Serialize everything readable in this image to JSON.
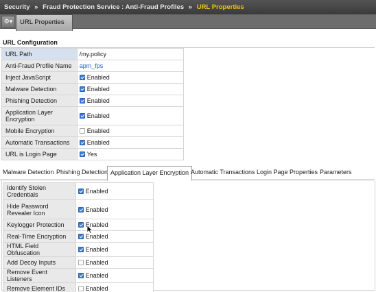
{
  "breadcrumb": {
    "items": [
      "Security",
      "Fraud Protection Service : Anti-Fraud Profiles",
      "URL Properties"
    ],
    "separator": "»"
  },
  "toolbar": {
    "gear_icon": "gear-icon",
    "gear_caret": "▾",
    "tab_label": "URL Properties"
  },
  "url_configuration": {
    "title": "URL Configuration",
    "rows": [
      {
        "label": "URL Path",
        "value": "/my.policy"
      },
      {
        "label": "Anti-Fraud Profile Name",
        "value": "apm_fps"
      },
      {
        "label": "Inject JavaScript",
        "checked": true,
        "value": "Enabled"
      },
      {
        "label": "Malware Detection",
        "checked": true,
        "value": "Enabled"
      },
      {
        "label": "Phishing Detection",
        "checked": true,
        "value": "Enabled"
      },
      {
        "label": "Application Layer Encryption",
        "checked": true,
        "value": "Enabled"
      },
      {
        "label": "Mobile Encryption",
        "checked": false,
        "value": "Enabled"
      },
      {
        "label": "Automatic Transactions",
        "checked": true,
        "value": "Enabled"
      },
      {
        "label": "URL is Login Page",
        "checked": true,
        "value": "Yes"
      }
    ]
  },
  "subtabs": {
    "items": [
      "Malware Detection",
      "Phishing Detection",
      "Application Layer Encryption",
      "Automatic Transactions",
      "Login Page Properties",
      "Parameters"
    ],
    "active_index": 2
  },
  "ale_options": {
    "rows": [
      {
        "label": "Identify Stolen Credentials",
        "checked": true,
        "value": "Enabled"
      },
      {
        "label": "Hide Password Revealer Icon",
        "checked": true,
        "value": "Enabled"
      },
      {
        "label": "Keylogger Protection",
        "checked": true,
        "value": "Enabled"
      },
      {
        "label": "Real-Time Encryption",
        "checked": true,
        "value": "Enabled"
      },
      {
        "label": "HTML Field Obfuscation",
        "checked": true,
        "value": "Enabled"
      },
      {
        "label": "Add Decoy Inputs",
        "checked": false,
        "value": "Enabled"
      },
      {
        "label": "Remove Event Listeners",
        "checked": true,
        "value": "Enabled"
      },
      {
        "label": "Remove Element IDs",
        "checked": false,
        "value": "Enabled"
      }
    ]
  },
  "colors": {
    "breadcrumb_current": "#f2c21b",
    "checkbox_checked": "#3d7ad3",
    "link": "#1f5fbf"
  }
}
